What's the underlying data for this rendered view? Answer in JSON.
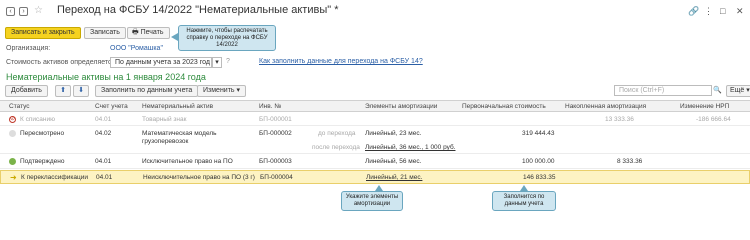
{
  "window": {
    "title": "Переход на ФСБУ 14/2022 \"Нематериальные активы\" *",
    "title_icons": [
      "back-arrow-icon",
      "forward-arrow-icon",
      "star-icon"
    ],
    "controls": [
      "link-icon",
      "more-icon",
      "maximize-icon",
      "close-icon"
    ]
  },
  "toolbar": {
    "post_and_close": "Записать и закрыть",
    "save": "Записать",
    "print": "Печать"
  },
  "org": {
    "label": "Организация:",
    "value": "ООО \"Ромашка\""
  },
  "cost": {
    "label": "Стоимость активов определяется:",
    "value": "По данным учета за 2023 год",
    "help_link": "Как заполнить данные для перехода на ФСБУ 14?"
  },
  "section": {
    "title": "Нематериальные активы на 1 января 2024 года"
  },
  "table_toolbar": {
    "add": "Добавить",
    "fill": "Заполнить по данным учета",
    "change": "Изменить"
  },
  "table": {
    "columns": [
      "Статус",
      "Счет учета",
      "Нематериальный актив",
      "Инв. №",
      "Элементы амортизации",
      "Первоначальная стоимость",
      "Накопленная амортизация",
      "Изменение НРП"
    ],
    "rows": [
      {
        "status": "К списанию",
        "account": "04.01",
        "asset": "Товарный знак",
        "inv": "БП-000001",
        "note": "",
        "amort": "",
        "initial": "",
        "accum": "13 333.36",
        "nrp": "-186 666.64"
      },
      {
        "status": "Пересмотрено",
        "account": "04.02",
        "asset": "Математическая модель грузоперевозок",
        "inv": "БП-000002",
        "note": "до перехода",
        "amort": "Линейный, 23 мес.",
        "initial": "319 444.43",
        "accum": "",
        "nrp": ""
      },
      {
        "status": "",
        "account": "",
        "asset": "",
        "inv": "",
        "note": "после перехода",
        "amort": "Линейный, 36 мес., 1 000 руб.",
        "initial": "",
        "accum": "",
        "nrp": ""
      },
      {
        "status": "Подтверждено",
        "account": "04.01",
        "asset": "Исключительное право на ПО",
        "inv": "БП-000003",
        "note": "",
        "amort": "Линейный, 56 мес.",
        "initial": "100 000.00",
        "accum": "8 333.36",
        "nrp": ""
      },
      {
        "status": "К переклассификации",
        "account": "04.01",
        "asset": "Неисключительное право на ПО (3 г)",
        "inv": "БП-000004",
        "note": "",
        "amort": "Линейный, 21 мес.",
        "initial": "146 833.35",
        "accum": "",
        "nrp": ""
      }
    ]
  },
  "tooltips": {
    "print": "Нажмите, чтобы распечатать справку о переходе на ФСБУ 14/2022",
    "amort": "Укажите элементы амортизации",
    "initial": "Заполнится по данным учета"
  },
  "colors": {
    "accent_yellow": "#f5d21f",
    "section_green": "#2e8b3d",
    "link_blue": "#2b5fa6",
    "tooltip_bg": "#cfe6f0",
    "selected_row": "#fdf3c3"
  }
}
